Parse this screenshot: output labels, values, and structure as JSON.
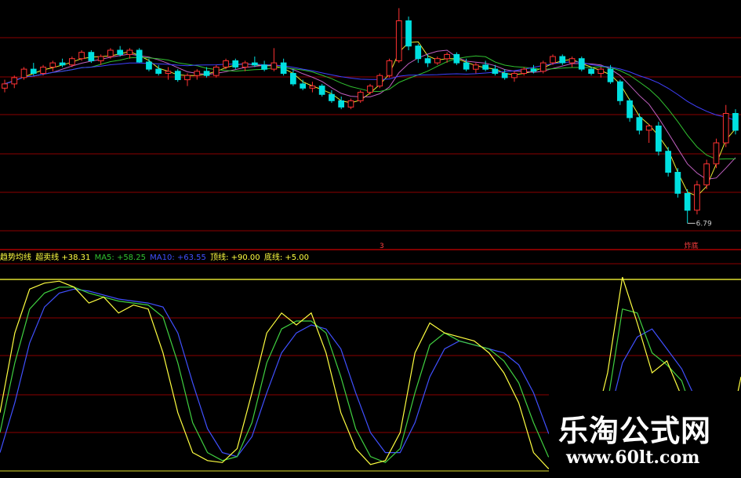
{
  "colors": {
    "up": "#ff3232",
    "down": "#00e0e0",
    "grid": "#8b0000",
    "divider": "#ff0000",
    "ma_yellow": "#e8e832",
    "ma_green": "#30c030",
    "ma_purple": "#c060c0",
    "ma_blue": "#4040ff",
    "osc_yellow": "#ffff40",
    "osc_green": "#40d040",
    "osc_blue": "#4050ff",
    "level_line": "#e0e030"
  },
  "price_panel": {
    "low_label": "6.79",
    "marker_label": "3",
    "bottom_tag": "炸底"
  },
  "indicator_legend": {
    "items": [
      {
        "text": "趋势均线",
        "color": "#ffff40"
      },
      {
        "text": "超卖线 +38.31",
        "color": "#ffff40"
      },
      {
        "text": "MA5: +58.25",
        "color": "#30c030"
      },
      {
        "text": "MA10: +63.55",
        "color": "#4050ff"
      },
      {
        "text": "顶线: +90.00",
        "color": "#ffff40"
      },
      {
        "text": "底线: +5.00",
        "color": "#ffff40"
      }
    ]
  },
  "watermark": {
    "title": "乐淘公式网",
    "url": "www.60lt.com"
  },
  "chart_data": [
    {
      "type": "candlestick",
      "description_of_series": "daily K-line with moving averages (no axis labels shown)",
      "y_range": [
        6.5,
        12.0
      ],
      "candles": [
        [
          10.0,
          10.2,
          9.9,
          10.1
        ],
        [
          10.1,
          10.3,
          10.0,
          10.25
        ],
        [
          10.25,
          10.5,
          10.2,
          10.45
        ],
        [
          10.45,
          10.6,
          10.3,
          10.35
        ],
        [
          10.35,
          10.55,
          10.3,
          10.5
        ],
        [
          10.5,
          10.65,
          10.4,
          10.6
        ],
        [
          10.6,
          10.7,
          10.5,
          10.55
        ],
        [
          10.55,
          10.75,
          10.5,
          10.7
        ],
        [
          10.7,
          10.9,
          10.65,
          10.85
        ],
        [
          10.85,
          10.9,
          10.6,
          10.65
        ],
        [
          10.65,
          10.8,
          10.55,
          10.75
        ],
        [
          10.75,
          10.95,
          10.7,
          10.9
        ],
        [
          10.9,
          11.0,
          10.75,
          10.8
        ],
        [
          10.8,
          10.95,
          10.7,
          10.9
        ],
        [
          10.9,
          10.95,
          10.6,
          10.62
        ],
        [
          10.62,
          10.7,
          10.4,
          10.45
        ],
        [
          10.45,
          10.55,
          10.3,
          10.35
        ],
        [
          10.35,
          10.5,
          10.2,
          10.4
        ],
        [
          10.4,
          10.45,
          10.15,
          10.2
        ],
        [
          10.2,
          10.35,
          10.05,
          10.3
        ],
        [
          10.3,
          10.45,
          10.2,
          10.4
        ],
        [
          10.4,
          10.5,
          10.25,
          10.3
        ],
        [
          10.3,
          10.55,
          10.25,
          10.5
        ],
        [
          10.5,
          10.7,
          10.45,
          10.65
        ],
        [
          10.65,
          10.7,
          10.45,
          10.5
        ],
        [
          10.5,
          10.65,
          10.4,
          10.6
        ],
        [
          10.6,
          10.75,
          10.5,
          10.55
        ],
        [
          10.55,
          10.65,
          10.4,
          10.45
        ],
        [
          10.45,
          10.95,
          10.4,
          10.6
        ],
        [
          10.6,
          10.7,
          10.3,
          10.35
        ],
        [
          10.35,
          10.45,
          10.05,
          10.1
        ],
        [
          10.1,
          10.2,
          9.95,
          10.0
        ],
        [
          10.0,
          10.15,
          9.9,
          10.05
        ],
        [
          10.05,
          10.1,
          9.8,
          9.85
        ],
        [
          9.85,
          9.95,
          9.65,
          9.7
        ],
        [
          9.7,
          9.8,
          9.5,
          9.55
        ],
        [
          9.55,
          9.75,
          9.5,
          9.7
        ],
        [
          9.7,
          9.95,
          9.65,
          9.9
        ],
        [
          9.9,
          10.1,
          9.85,
          10.05
        ],
        [
          10.05,
          10.35,
          10.0,
          10.3
        ],
        [
          10.3,
          10.7,
          10.25,
          10.65
        ],
        [
          10.65,
          11.9,
          10.6,
          11.6
        ],
        [
          11.6,
          11.7,
          10.9,
          11.0
        ],
        [
          11.0,
          11.05,
          10.6,
          10.7
        ],
        [
          10.7,
          10.8,
          10.5,
          10.6
        ],
        [
          10.6,
          10.75,
          10.55,
          10.7
        ],
        [
          10.7,
          10.85,
          10.6,
          10.8
        ],
        [
          10.8,
          10.85,
          10.55,
          10.6
        ],
        [
          10.6,
          10.7,
          10.4,
          10.45
        ],
        [
          10.45,
          10.6,
          10.35,
          10.55
        ],
        [
          10.55,
          10.65,
          10.4,
          10.45
        ],
        [
          10.45,
          10.55,
          10.3,
          10.35
        ],
        [
          10.35,
          10.45,
          10.2,
          10.25
        ],
        [
          10.25,
          10.4,
          10.15,
          10.35
        ],
        [
          10.35,
          10.5,
          10.3,
          10.45
        ],
        [
          10.45,
          10.55,
          10.35,
          10.4
        ],
        [
          10.4,
          10.65,
          10.35,
          10.6
        ],
        [
          10.6,
          10.8,
          10.55,
          10.75
        ],
        [
          10.75,
          10.8,
          10.55,
          10.6
        ],
        [
          10.6,
          10.75,
          10.5,
          10.7
        ],
        [
          10.7,
          10.75,
          10.4,
          10.45
        ],
        [
          10.45,
          10.5,
          10.3,
          10.35
        ],
        [
          10.35,
          10.5,
          10.25,
          10.45
        ],
        [
          10.45,
          10.55,
          10.1,
          10.15
        ],
        [
          10.15,
          10.2,
          9.6,
          9.7
        ],
        [
          9.7,
          9.75,
          9.2,
          9.3
        ],
        [
          9.3,
          9.4,
          8.9,
          9.0
        ],
        [
          9.0,
          9.15,
          8.7,
          9.1
        ],
        [
          9.1,
          9.2,
          8.4,
          8.5
        ],
        [
          8.5,
          8.6,
          7.9,
          8.0
        ],
        [
          8.0,
          8.1,
          7.4,
          7.5
        ],
        [
          7.5,
          7.6,
          6.79,
          7.1
        ],
        [
          7.1,
          7.8,
          7.0,
          7.7
        ],
        [
          7.7,
          8.3,
          7.6,
          8.2
        ],
        [
          8.2,
          8.8,
          8.1,
          8.7
        ],
        [
          8.7,
          9.6,
          8.6,
          9.4
        ],
        [
          9.4,
          9.5,
          8.9,
          9.0
        ]
      ]
    },
    {
      "type": "line",
      "description_of_series": "oscillator sub-chart",
      "y_range": [
        0,
        100
      ],
      "top_line": 90,
      "bottom_line": 5,
      "series": [
        {
          "name": "趋势均线",
          "color": "#ffff40",
          "values": [
            30,
            70,
            92,
            95,
            96,
            93,
            85,
            88,
            80,
            84,
            82,
            60,
            30,
            10,
            6,
            5,
            12,
            40,
            70,
            80,
            74,
            80,
            60,
            30,
            12,
            4,
            6,
            20,
            60,
            75,
            70,
            68,
            66,
            60,
            50,
            35,
            10,
            2,
            5,
            10,
            20,
            50,
            98,
            75,
            50,
            56,
            38,
            10,
            4,
            12,
            48
          ]
        },
        {
          "name": "MA5: +58.25",
          "color": "#40d040",
          "values": [
            20,
            55,
            82,
            90,
            93,
            93,
            90,
            88,
            86,
            85,
            84,
            78,
            55,
            25,
            10,
            6,
            8,
            25,
            55,
            72,
            76,
            76,
            70,
            48,
            22,
            8,
            5,
            12,
            40,
            64,
            70,
            66,
            64,
            62,
            56,
            45,
            25,
            8,
            4,
            6,
            14,
            35,
            82,
            80,
            60,
            54,
            46,
            24,
            8,
            8,
            30
          ]
        },
        {
          "name": "MA10: +63.55",
          "color": "#4050ff",
          "values": [
            10,
            35,
            65,
            83,
            90,
            92,
            91,
            89,
            87,
            86,
            85,
            83,
            70,
            45,
            22,
            10,
            8,
            18,
            40,
            60,
            70,
            74,
            72,
            62,
            40,
            20,
            10,
            10,
            25,
            48,
            62,
            66,
            64,
            62,
            60,
            54,
            40,
            20,
            8,
            5,
            10,
            25,
            55,
            68,
            72,
            62,
            52,
            36,
            18,
            10,
            22
          ]
        }
      ]
    }
  ]
}
